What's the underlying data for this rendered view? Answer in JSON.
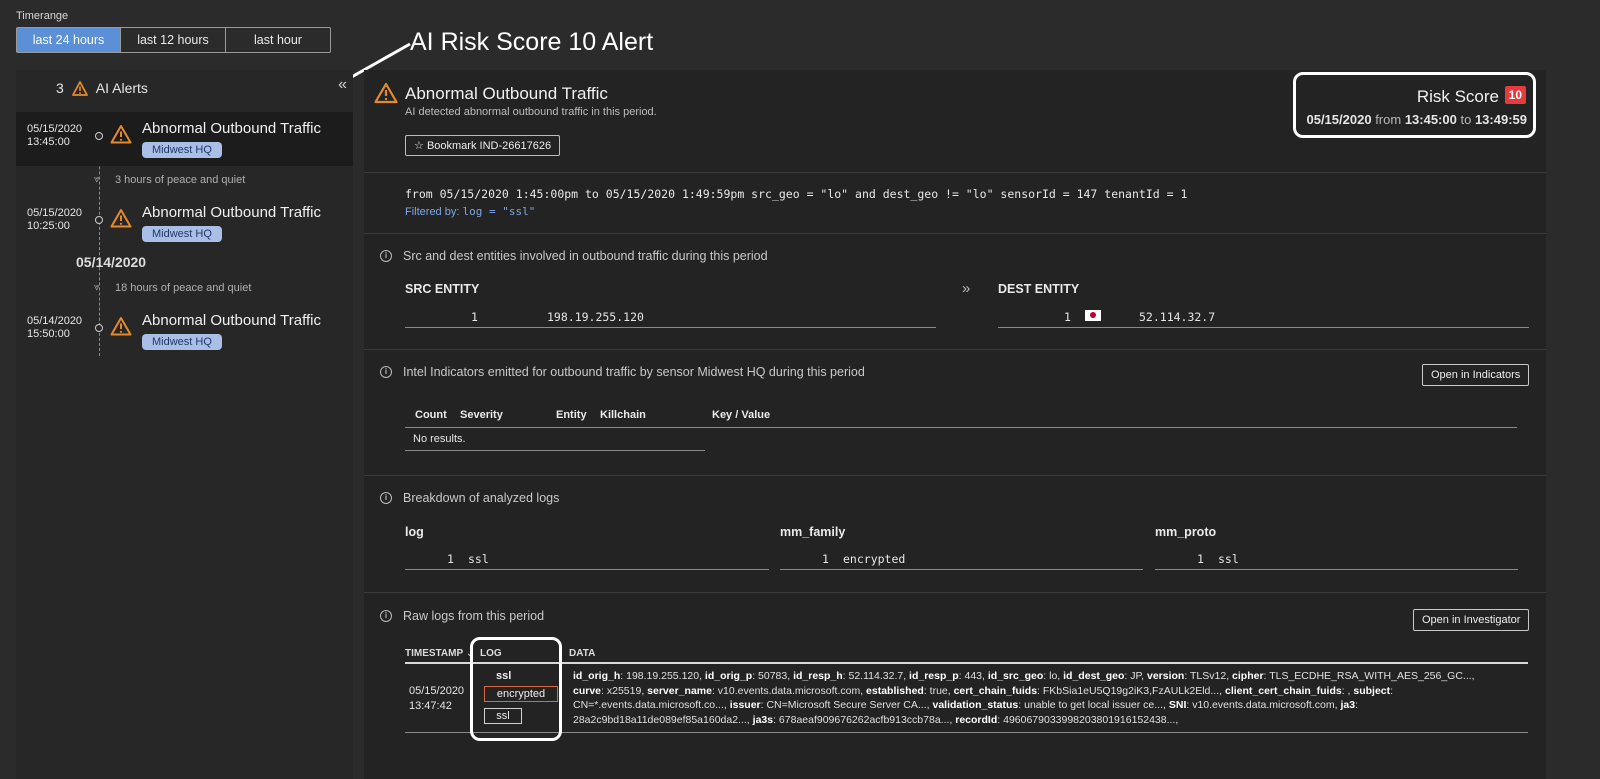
{
  "timerange": {
    "label": "Timerange",
    "options": [
      {
        "label": "last 24 hours",
        "active": true
      },
      {
        "label": "last 12 hours",
        "active": false
      },
      {
        "label": "last hour",
        "active": false
      }
    ]
  },
  "annotation": "AI Risk Score 10 Alert",
  "sidebar": {
    "count": "3",
    "title": "AI Alerts",
    "alerts": [
      {
        "date": "05/15/2020",
        "time": "13:45:00",
        "title": "Abnormal Outbound Traffic",
        "sensor": "Midwest HQ"
      },
      {
        "date": "05/15/2020",
        "time": "10:25:00",
        "title": "Abnormal Outbound Traffic",
        "sensor": "Midwest HQ"
      },
      {
        "date": "05/14/2020",
        "time": "15:50:00",
        "title": "Abnormal Outbound Traffic",
        "sensor": "Midwest HQ"
      }
    ],
    "gaps": [
      "3 hours of peace and quiet",
      "18 hours of peace and quiet"
    ],
    "date_separator": "05/14/2020"
  },
  "detail": {
    "title": "Abnormal Outbound Traffic",
    "subtitle": "AI detected abnormal outbound traffic in this period.",
    "bookmark": "Bookmark IND-26617626",
    "risk": {
      "label": "Risk Score",
      "value": "10",
      "date": "05/15/2020",
      "from_word": "from",
      "from": "13:45:00",
      "to_word": "to",
      "to": "13:49:59"
    },
    "query": "from 05/15/2020 1:45:00pm to 05/15/2020 1:49:59pm src_geo = \"lo\" and dest_geo != \"lo\" sensorId = 147 tenantId = 1",
    "filtered_label": "Filtered by:",
    "filtered_value": "log = \"ssl\"",
    "entities": {
      "title": "Src and dest entities involved in outbound traffic during this period",
      "src_header": "SRC ENTITY",
      "dest_header": "DEST ENTITY",
      "src": {
        "count": "1",
        "value": "198.19.255.120"
      },
      "dest": {
        "count": "1",
        "value": "52.114.32.7",
        "flag": "japan-flag-icon"
      }
    },
    "indicators": {
      "title": "Intel Indicators emitted for outbound traffic by sensor Midwest HQ during this period",
      "button": "Open in Indicators",
      "columns": [
        "Count",
        "Severity",
        "Entity",
        "Killchain",
        "Key / Value"
      ],
      "empty": "No results."
    },
    "breakdown": {
      "title": "Breakdown of analyzed logs",
      "columns": [
        {
          "header": "log",
          "count": "1",
          "value": "ssl"
        },
        {
          "header": "mm_family",
          "count": "1",
          "value": "encrypted"
        },
        {
          "header": "mm_proto",
          "count": "1",
          "value": "ssl"
        }
      ]
    },
    "raw": {
      "title": "Raw logs from this period",
      "button": "Open in Investigator",
      "col_timestamp": "TIMESTAMP",
      "col_log": "LOG",
      "col_data": "DATA",
      "row": {
        "date": "05/15/2020",
        "time": "13:47:42",
        "log_plain": "ssl",
        "log_family": "encrypted",
        "log_proto": "ssl"
      }
    }
  },
  "colors": {
    "accent_blue": "#5b8fd6",
    "warning_orange": "#e58a2c",
    "risk_red": "#e8393d",
    "badge_blue": "#a9bfe6"
  }
}
